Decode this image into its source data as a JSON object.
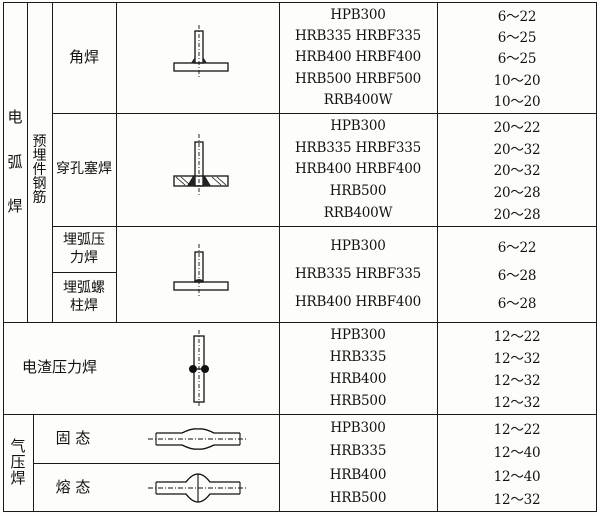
{
  "table": {
    "category_arc": [
      "电",
      "弧",
      "焊"
    ],
    "subcategory_embedded": [
      "预",
      "埋",
      "件",
      "钢",
      "筋"
    ],
    "category_gas": [
      "气",
      "压",
      "焊"
    ],
    "rows": {
      "fillet": {
        "method": "角焊",
        "grades": [
          "HPB300",
          "HRB335 HRBF335",
          "HRB400 HRBF400",
          "HRB500 HRBF500",
          "RRB400W"
        ],
        "diameters": [
          "6～22",
          "6～25",
          "6～25",
          "10～20",
          "10～20"
        ]
      },
      "plug": {
        "method": "穿孔塞焊",
        "grades": [
          "HPB300",
          "HRB335 HRBF335",
          "HRB400 HRBF400",
          "HRB500",
          "RRB400W"
        ],
        "diameters": [
          "20～22",
          "20～32",
          "20～32",
          "20～28",
          "20～28"
        ]
      },
      "submerged": {
        "method_a": "埋弧压力焊",
        "method_b": "埋弧螺柱焊",
        "grades": [
          "HPB300",
          "HRB335 HRBF335",
          "HRB400 HRBF400"
        ],
        "diameters": [
          "6～22",
          "6～28",
          "6～28"
        ]
      },
      "electroslag": {
        "method": "电渣压力焊",
        "grades": [
          "HPB300",
          "HRB335",
          "HRB400",
          "HRB500"
        ],
        "diameters": [
          "12～22",
          "12～32",
          "12～32",
          "12～32"
        ]
      },
      "gas": {
        "method_solid": "固 态",
        "method_molten": "熔 态",
        "grades": [
          "HPB300",
          "HRB335",
          "HRB400",
          "HRB500"
        ],
        "diameters": [
          "12～22",
          "12～40",
          "12～40",
          "12～32"
        ]
      }
    }
  }
}
